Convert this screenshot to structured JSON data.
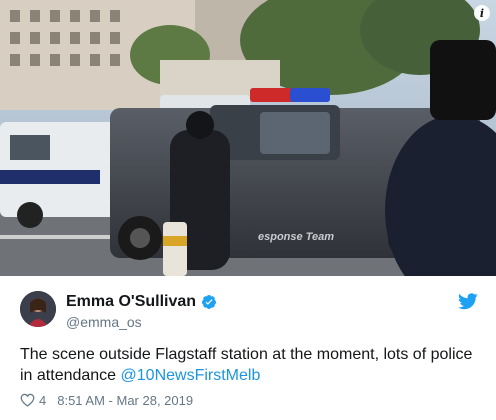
{
  "tweet": {
    "display_name": "Emma O'Sullivan",
    "handle": "@emma_os",
    "text_before_mention": "The scene outside Flagstaff station at the moment, lots of police in attendance ",
    "mention": "@10NewsFirstMelb",
    "like_count": "4",
    "timestamp": "8:51 AM - Mar 28, 2019"
  },
  "media": {
    "vehicle_decal_text": "esponse Team"
  },
  "icons": {
    "verified": "verified-badge-icon",
    "twitter_logo": "twitter-bird-icon",
    "like": "heart-icon",
    "info": "info-icon"
  },
  "colors": {
    "brand_blue": "#1da1f2",
    "link_blue": "#1b95e0",
    "text_primary": "#14171a",
    "text_secondary": "#657786"
  }
}
